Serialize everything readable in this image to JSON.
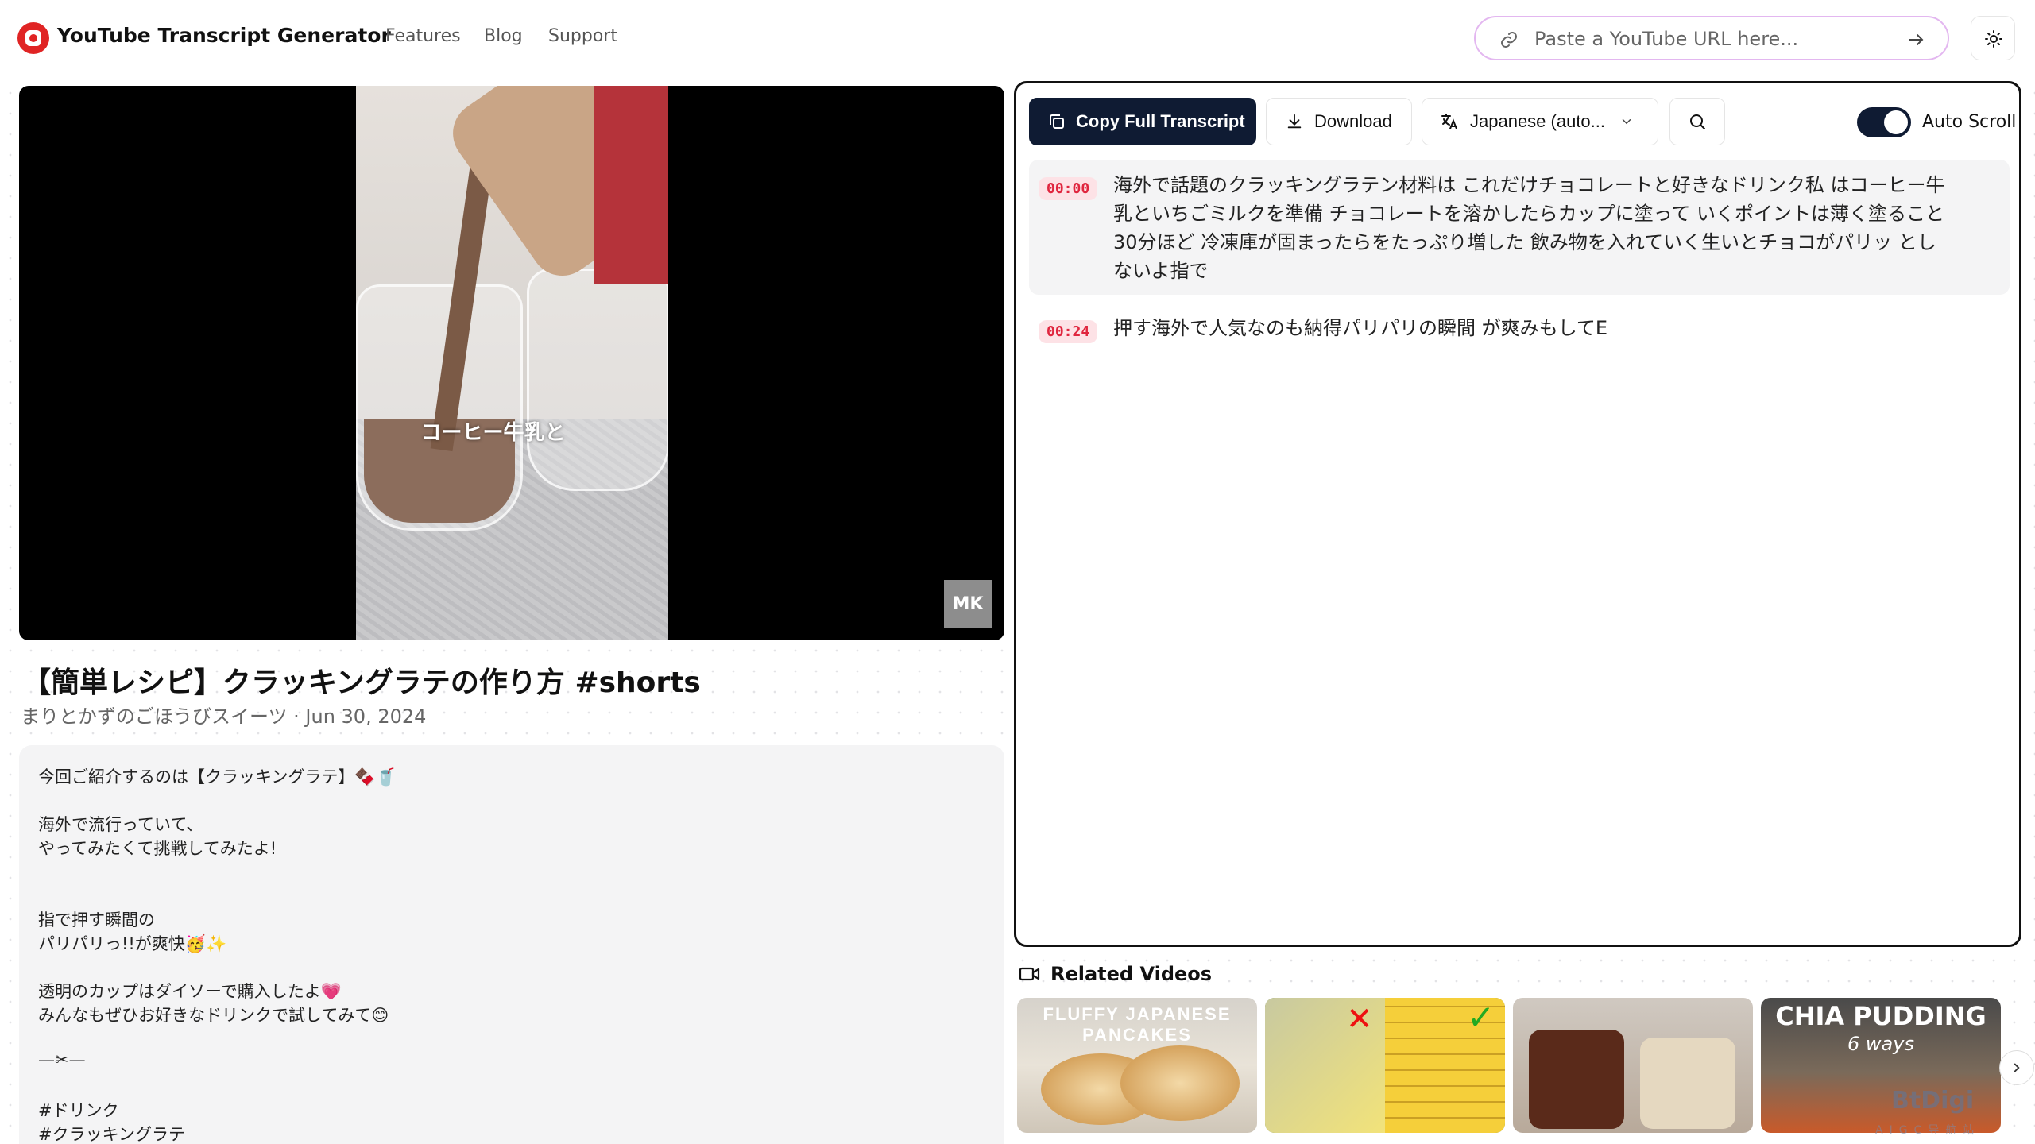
{
  "header": {
    "app_title": "YouTube Transcript Generator",
    "nav": [
      "Features",
      "Blog",
      "Support"
    ],
    "search_placeholder": "Paste a YouTube URL here..."
  },
  "video": {
    "subtitle_overlay": "コーヒー牛乳と",
    "watermark": "MK",
    "title": "【簡単レシピ】クラッキングラテの作り方 #shorts",
    "meta": "まりとかずのごほうびスイーツ · Jun 30, 2024",
    "description_lines": [
      "今回ご紹介するのは【クラッキングラテ】🍫🥤",
      "",
      "海外で流行っていて、",
      "やってみたくて挑戦してみたよ!",
      "",
      "",
      "指で押す瞬間の",
      "パリパリっ!!が爽快🥳✨",
      "",
      "透明のカップはダイソーで購入したよ💗",
      "みんなもぜひお好きなドリンクで試してみて😊",
      "",
      "—✂—",
      "",
      "#ドリンク",
      "#クラッキングラテ"
    ]
  },
  "transcript": {
    "copy_label": "Copy Full Transcript",
    "download_label": "Download",
    "language": "Japanese (auto...",
    "auto_scroll_label": "Auto Scroll",
    "auto_scroll_on": true,
    "segments": [
      {
        "time": "00:00",
        "lines": [
          "海外で話題のクラッキングラテン材料は これだけチョコレートと好きなドリンク私 はコーヒー牛",
          "乳といちごミルクを準備 チョコレートを溶かしたらカップに塗って いくポイントは薄く塗ること",
          "30分ほど 冷凍庫が固まったらをたっぷり増した 飲み物を入れていく生いとチョコがパリッ とし",
          "ないよ指で"
        ]
      },
      {
        "time": "00:24",
        "lines": [
          "押す海外で人気なのも納得パリパリの瞬間 が爽みもしてE"
        ]
      }
    ]
  },
  "related": {
    "heading": "Related Videos",
    "thumbnails": [
      {
        "title": "FLUFFY JAPANESE PANCAKES",
        "subtitle": ""
      },
      {
        "title": "",
        "subtitle": ""
      },
      {
        "title": "",
        "subtitle": ""
      },
      {
        "title": "CHIA PUDDING",
        "subtitle": "6 ways"
      }
    ]
  },
  "corner_watermark": {
    "text": "BtDigi",
    "sub": "AIGC导航站"
  },
  "colors": {
    "accent_dark": "#0f1b33",
    "timestamp_red": "#e0263f",
    "timestamp_bg": "#fde2e6",
    "logo_red": "#e02424"
  }
}
